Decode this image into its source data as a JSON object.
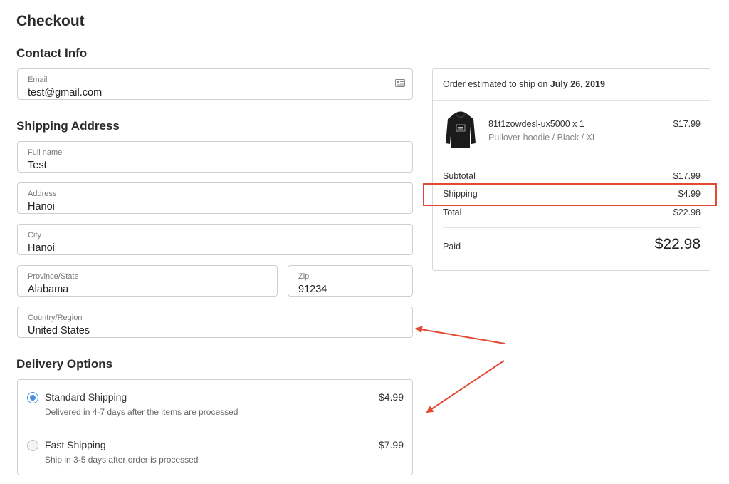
{
  "page": {
    "title": "Checkout"
  },
  "contact": {
    "heading": "Contact Info",
    "email": {
      "label": "Email",
      "value": "test@gmail.com",
      "icon": "contact-card-icon"
    }
  },
  "shipping": {
    "heading": "Shipping Address",
    "full_name": {
      "label": "Full name",
      "value": "Test"
    },
    "address": {
      "label": "Address",
      "value": "Hanoi"
    },
    "city": {
      "label": "City",
      "value": "Hanoi"
    },
    "province": {
      "label": "Province/State",
      "value": "Alabama"
    },
    "zip": {
      "label": "Zip",
      "value": "91234"
    },
    "country": {
      "label": "Country/Region",
      "value": "United States"
    }
  },
  "delivery": {
    "heading": "Delivery Options",
    "options": [
      {
        "title": "Standard Shipping",
        "subtitle": "Delivered in 4-7 days after the items are processed",
        "price": "$4.99",
        "selected": true
      },
      {
        "title": "Fast Shipping",
        "subtitle": "Ship in 3-5 days after order is processed",
        "price": "$7.99",
        "selected": false
      }
    ]
  },
  "summary": {
    "ship_text": "Order estimated to ship on",
    "ship_date": "July 26, 2019",
    "item": {
      "name": "81t1zowdesl-ux5000 x 1",
      "variant": "Pullover hoodie / Black / XL",
      "price": "$17.99",
      "icon": "hoodie-thumbnail"
    },
    "subtotal_label": "Subtotal",
    "subtotal_value": "$17.99",
    "shipping_label": "Shipping",
    "shipping_value": "$4.99",
    "total_label": "Total",
    "total_value": "$22.98",
    "paid_label": "Paid",
    "paid_value": "$22.98"
  },
  "colors": {
    "accent": "#4a90e2",
    "annotation": "#e24a33"
  }
}
